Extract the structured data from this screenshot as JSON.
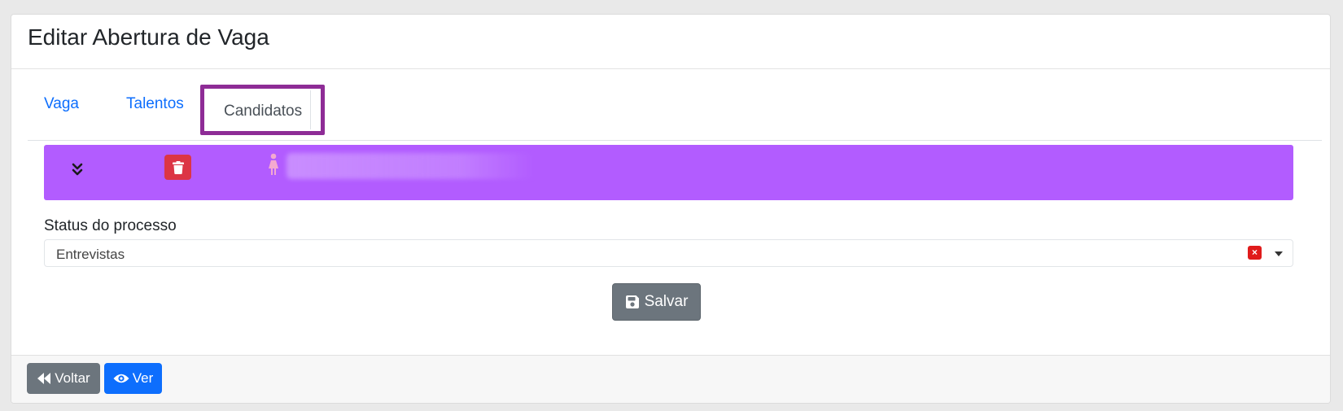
{
  "header": {
    "title": "Editar Abertura de Vaga"
  },
  "tabs": [
    {
      "label": "Vaga",
      "active": false
    },
    {
      "label": "Talentos",
      "active": false
    },
    {
      "label": "Candidatos",
      "active": true
    }
  ],
  "candidate": {
    "bar_color": "#b25cff",
    "icons": [
      "chevron-double-down-icon",
      "trash-icon",
      "female-person-icon"
    ]
  },
  "form": {
    "status_label": "Status do processo",
    "status_value": "Entrevistas",
    "clear_symbol": "×",
    "save_label": "Salvar"
  },
  "footer": {
    "back_label": "Voltar",
    "view_label": "Ver"
  },
  "colors": {
    "primary": "#0d6efd",
    "secondary": "#6c757d",
    "danger": "#dc3545",
    "highlight": "#8e2c96"
  }
}
